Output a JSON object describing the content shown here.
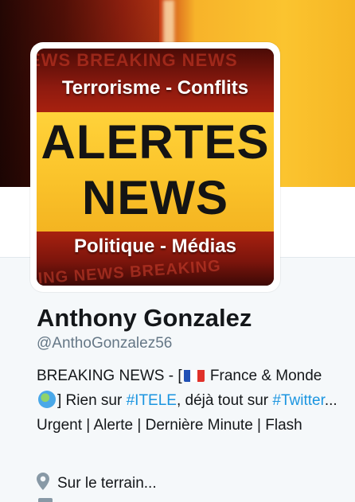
{
  "banner": {
    "colors": {
      "left": "#5e1208",
      "right": "#fbc42f"
    }
  },
  "avatar": {
    "watermark_top": "EWS BREAKING NEWS",
    "top_subtitle": "Terrorisme - Conflits",
    "headline_line1": "ALERTES",
    "headline_line2": "NEWS",
    "bottom_subtitle": "Politique - Médias",
    "watermark_bottom": "KING NEWS BREAKING"
  },
  "profile": {
    "name": "Anthony Gonzalez",
    "handle": "@AnthoGonzalez56",
    "bio": {
      "part1": "BREAKING NEWS - [",
      "part2": " France & Monde ",
      "part3": "] Rien sur ",
      "tag1": "#ITELE",
      "part4": ", déjà tout sur ",
      "tag2": "#Twitter",
      "part5": "... Urgent | Alerte | Dernière Minute | Flash"
    },
    "location": "Sur le terrain..."
  },
  "icons": {
    "flag": "france-flag-icon",
    "globe": "globe-icon",
    "location": "location-pin-icon"
  },
  "colors": {
    "link": "#1b95e0",
    "secondary_text": "#657786",
    "primary_text": "#14171a"
  }
}
